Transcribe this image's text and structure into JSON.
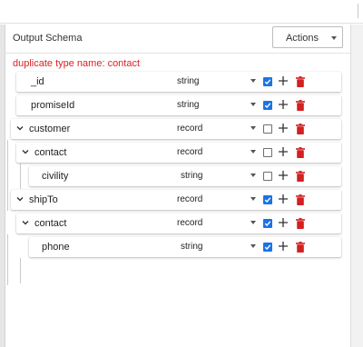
{
  "panel": {
    "title": "Output Schema",
    "actions_label": "Actions",
    "error": "duplicate type name: contact"
  },
  "rows": [
    {
      "name": "_id",
      "type": "string",
      "checked": true,
      "expandable": false
    },
    {
      "name": "promiseId",
      "type": "string",
      "checked": true,
      "expandable": false
    },
    {
      "name": "customer",
      "type": "record",
      "checked": false,
      "expandable": true
    },
    {
      "name": "contact",
      "type": "record",
      "checked": false,
      "expandable": true
    },
    {
      "name": "civility",
      "type": "string",
      "checked": false,
      "expandable": false
    },
    {
      "name": "shipTo",
      "type": "record",
      "checked": true,
      "expandable": true
    },
    {
      "name": "contact",
      "type": "record",
      "checked": true,
      "expandable": true
    },
    {
      "name": "phone",
      "type": "string",
      "checked": true,
      "expandable": false
    }
  ],
  "colors": {
    "accent": "#1a73e8",
    "delete": "#d32020",
    "error": "#e02020"
  },
  "icons": {
    "expand": "chevron-down-icon",
    "type_menu": "caret-down-icon",
    "add": "plus-icon",
    "delete": "trash-icon",
    "checkbox": "checkbox-icon"
  }
}
